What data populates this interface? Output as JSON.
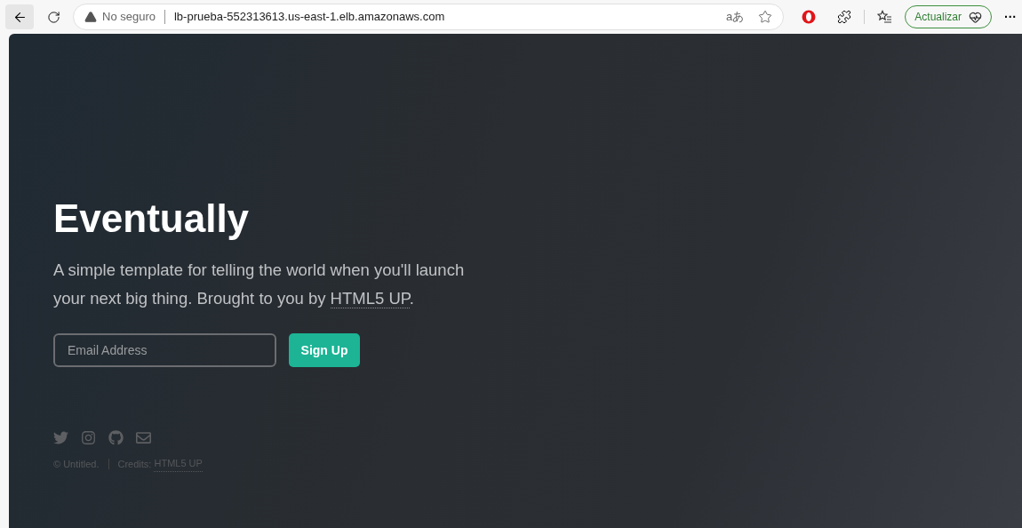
{
  "browser": {
    "security_label": "No seguro",
    "url": "lb-prueba-552313613.us-east-1.elb.amazonaws.com",
    "translate_glyph": "aあ",
    "update_button": "Actualizar",
    "more_menu": "···"
  },
  "hero": {
    "title": "Eventually",
    "description": "A simple template for telling the world when you'll launch your next big thing. Brought to you by ",
    "description_link": "HTML5 UP",
    "description_end": ".",
    "email": {
      "placeholder": "Email Address"
    },
    "signup_button": "Sign Up"
  },
  "footer": {
    "social": [
      {
        "kind": "twitter"
      },
      {
        "kind": "instagram"
      },
      {
        "kind": "github"
      },
      {
        "kind": "email"
      }
    ],
    "copyright": "© Untitled.",
    "credits_label": "Credits: ",
    "credits_link": "HTML5 UP"
  }
}
